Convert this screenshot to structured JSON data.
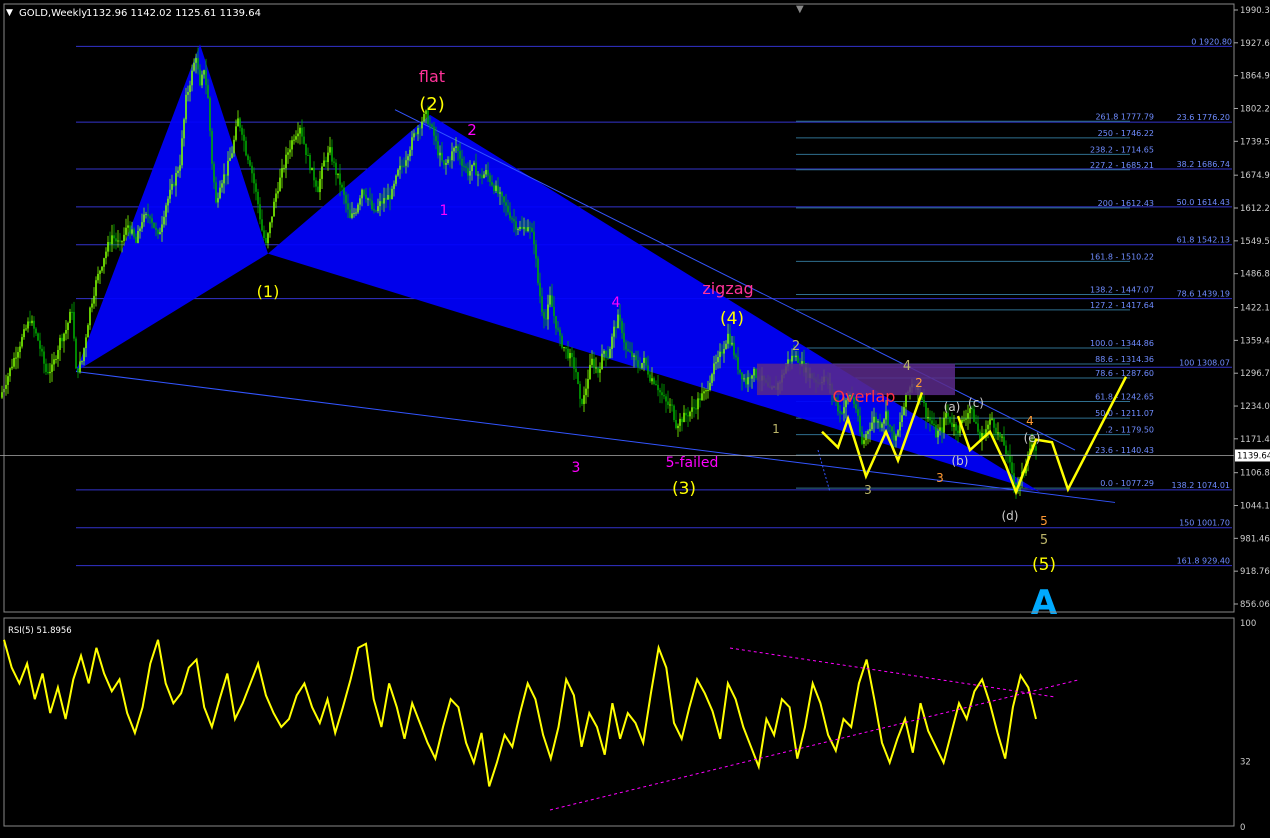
{
  "header": {
    "symbol_label": "GOLD,Weekly",
    "ohlc": "1132.96 1142.02 1125.61 1139.64",
    "current_price": "1139.64"
  },
  "colors": {
    "background": "#000000",
    "candle_up": "#7fff00",
    "candle_down": "#00aa00",
    "triangle": "#0000ff",
    "fib_line": "#3333cc",
    "wave_yellow": "#ffff00",
    "wave_magenta": "#ff00ff",
    "wave_olive": "#bdb76b",
    "wave_orange": "#ff9933",
    "label_red": "#ff3344",
    "big_a": "#00aaff",
    "rsi_line": "#ffff00",
    "trend_dash": "#ff00ff",
    "overlap_box": "#5a2a8a"
  },
  "chart_data": [
    {
      "type": "candlestick",
      "title": "GOLD,Weekly",
      "ylim": [
        856.06,
        1990.3
      ],
      "y_ticks": [
        "1990.30",
        "1927.66",
        "1864.96",
        "1802.26",
        "1739.56",
        "1674.90",
        "1612.20",
        "1549.50",
        "1486.80",
        "1422.16",
        "1359.46",
        "1296.76",
        "1234.06",
        "1171.46",
        "1106.80",
        "1044.16",
        "981.46",
        "918.76",
        "856.06"
      ],
      "x_ticks": [],
      "close_path": [
        [
          0,
          1250
        ],
        [
          15,
          1330
        ],
        [
          30,
          1400
        ],
        [
          38,
          1360
        ],
        [
          46,
          1300
        ],
        [
          52,
          1305
        ],
        [
          60,
          1360
        ],
        [
          66,
          1380
        ],
        [
          72,
          1420
        ],
        [
          76,
          1300
        ],
        [
          82,
          1320
        ],
        [
          90,
          1420
        ],
        [
          96,
          1470
        ],
        [
          104,
          1520
        ],
        [
          112,
          1560
        ],
        [
          120,
          1540
        ],
        [
          128,
          1580
        ],
        [
          136,
          1545
        ],
        [
          142,
          1590
        ],
        [
          150,
          1600
        ],
        [
          158,
          1555
        ],
        [
          166,
          1620
        ],
        [
          172,
          1650
        ],
        [
          180,
          1700
        ],
        [
          186,
          1820
        ],
        [
          192,
          1870
        ],
        [
          196,
          1905
        ],
        [
          200,
          1840
        ],
        [
          204,
          1880
        ],
        [
          208,
          1820
        ],
        [
          212,
          1700
        ],
        [
          216,
          1620
        ],
        [
          220,
          1660
        ],
        [
          226,
          1680
        ],
        [
          232,
          1720
        ],
        [
          238,
          1780
        ],
        [
          242,
          1760
        ],
        [
          246,
          1720
        ],
        [
          250,
          1700
        ],
        [
          254,
          1660
        ],
        [
          258,
          1620
        ],
        [
          262,
          1570
        ],
        [
          266,
          1540
        ],
        [
          270,
          1580
        ],
        [
          276,
          1640
        ],
        [
          282,
          1680
        ],
        [
          288,
          1720
        ],
        [
          294,
          1750
        ],
        [
          300,
          1770
        ],
        [
          306,
          1720
        ],
        [
          312,
          1680
        ],
        [
          318,
          1650
        ],
        [
          324,
          1700
        ],
        [
          330,
          1720
        ],
        [
          336,
          1680
        ],
        [
          340,
          1660
        ],
        [
          346,
          1620
        ],
        [
          350,
          1590
        ],
        [
          356,
          1610
        ],
        [
          362,
          1650
        ],
        [
          368,
          1630
        ],
        [
          374,
          1600
        ],
        [
          380,
          1620
        ],
        [
          386,
          1630
        ],
        [
          392,
          1640
        ],
        [
          398,
          1680
        ],
        [
          404,
          1700
        ],
        [
          410,
          1730
        ],
        [
          416,
          1760
        ],
        [
          422,
          1780
        ],
        [
          426,
          1790
        ],
        [
          430,
          1770
        ],
        [
          434,
          1750
        ],
        [
          438,
          1720
        ],
        [
          444,
          1690
        ],
        [
          450,
          1710
        ],
        [
          456,
          1730
        ],
        [
          462,
          1700
        ],
        [
          468,
          1680
        ],
        [
          474,
          1690
        ],
        [
          480,
          1670
        ],
        [
          486,
          1680
        ],
        [
          492,
          1660
        ],
        [
          498,
          1640
        ],
        [
          504,
          1620
        ],
        [
          510,
          1600
        ],
        [
          516,
          1580
        ],
        [
          522,
          1570
        ],
        [
          528,
          1580
        ],
        [
          534,
          1550
        ],
        [
          538,
          1470
        ],
        [
          542,
          1420
        ],
        [
          546,
          1400
        ],
        [
          550,
          1440
        ],
        [
          556,
          1390
        ],
        [
          560,
          1360
        ],
        [
          566,
          1340
        ],
        [
          572,
          1320
        ],
        [
          576,
          1300
        ],
        [
          580,
          1240
        ],
        [
          584,
          1250
        ],
        [
          588,
          1290
        ],
        [
          592,
          1320
        ],
        [
          598,
          1300
        ],
        [
          604,
          1340
        ],
        [
          608,
          1330
        ],
        [
          614,
          1380
        ],
        [
          618,
          1400
        ],
        [
          622,
          1380
        ],
        [
          626,
          1340
        ],
        [
          632,
          1330
        ],
        [
          638,
          1310
        ],
        [
          644,
          1320
        ],
        [
          650,
          1290
        ],
        [
          656,
          1280
        ],
        [
          660,
          1260
        ],
        [
          666,
          1240
        ],
        [
          672,
          1230
        ],
        [
          676,
          1200
        ],
        [
          682,
          1210
        ],
        [
          688,
          1220
        ],
        [
          694,
          1230
        ],
        [
          700,
          1250
        ],
        [
          706,
          1260
        ],
        [
          712,
          1300
        ],
        [
          718,
          1320
        ],
        [
          722,
          1340
        ],
        [
          728,
          1370
        ],
        [
          732,
          1350
        ],
        [
          736,
          1320
        ],
        [
          740,
          1300
        ],
        [
          746,
          1280
        ],
        [
          752,
          1300
        ],
        [
          758,
          1290
        ],
        [
          764,
          1280
        ],
        [
          770,
          1260
        ],
        [
          776,
          1270
        ],
        [
          782,
          1290
        ],
        [
          788,
          1320
        ],
        [
          794,
          1330
        ],
        [
          800,
          1320
        ],
        [
          806,
          1300
        ],
        [
          812,
          1290
        ],
        [
          818,
          1280
        ],
        [
          824,
          1290
        ],
        [
          830,
          1270
        ],
        [
          836,
          1240
        ],
        [
          840,
          1220
        ],
        [
          846,
          1240
        ],
        [
          850,
          1260
        ],
        [
          856,
          1230
        ],
        [
          862,
          1160
        ],
        [
          868,
          1190
        ],
        [
          874,
          1210
        ],
        [
          880,
          1200
        ],
        [
          886,
          1220
        ],
        [
          892,
          1180
        ],
        [
          896,
          1170
        ],
        [
          900,
          1200
        ],
        [
          906,
          1250
        ],
        [
          912,
          1280
        ],
        [
          918,
          1270
        ],
        [
          922,
          1250
        ],
        [
          926,
          1220
        ],
        [
          932,
          1200
        ],
        [
          936,
          1180
        ],
        [
          942,
          1190
        ],
        [
          946,
          1220
        ],
        [
          952,
          1200
        ],
        [
          958,
          1190
        ],
        [
          964,
          1210
        ],
        [
          970,
          1230
        ],
        [
          976,
          1200
        ],
        [
          980,
          1170
        ],
        [
          986,
          1190
        ],
        [
          992,
          1210
        ],
        [
          998,
          1180
        ],
        [
          1004,
          1160
        ],
        [
          1010,
          1120
        ],
        [
          1016,
          1080
        ],
        [
          1020,
          1090
        ],
        [
          1024,
          1110
        ],
        [
          1028,
          1150
        ],
        [
          1032,
          1160
        ],
        [
          1036,
          1140
        ]
      ],
      "wave_labels": [
        {
          "text": "flat",
          "color": "#ff3399"
        },
        {
          "text": "(2)",
          "color": "#ffff00"
        },
        {
          "text": "2",
          "color": "#ff00ff"
        },
        {
          "text": "1",
          "color": "#ff00ff"
        },
        {
          "text": "(1)",
          "color": "#ffff00"
        },
        {
          "text": "4",
          "color": "#ff00ff"
        },
        {
          "text": "zigzag",
          "color": "#ff3399"
        },
        {
          "text": "(4)",
          "color": "#ffff00"
        },
        {
          "text": "3",
          "color": "#ff00ff"
        },
        {
          "text": "5-failed",
          "color": "#ff00ff"
        },
        {
          "text": "(3)",
          "color": "#ffff00"
        },
        {
          "text": "2",
          "color": "#bdb76b"
        },
        {
          "text": "1",
          "color": "#bdb76b"
        },
        {
          "text": "Overlap",
          "color": "#ff3344"
        },
        {
          "text": "3",
          "color": "#bdb76b"
        },
        {
          "text": "4",
          "color": "#bdb76b"
        },
        {
          "text": "2",
          "color": "#ff9933"
        },
        {
          "text": "3",
          "color": "#ff9933"
        },
        {
          "text": "4",
          "color": "#ff9933"
        },
        {
          "text": "5",
          "color": "#ff9933"
        },
        {
          "text": "5",
          "color": "#bdb76b"
        },
        {
          "text": "(5)",
          "color": "#ffff00"
        },
        {
          "text": "(a)",
          "color": "#cccccc"
        },
        {
          "text": "(c)",
          "color": "#cccccc"
        },
        {
          "text": "(b)",
          "color": "#cccccc"
        },
        {
          "text": "(e)",
          "color": "#cccccc"
        },
        {
          "text": "(d)",
          "color": "#cccccc"
        },
        {
          "text": "A",
          "color": "#00aaff"
        }
      ],
      "fib_left": [
        {
          "text": "0 1920.80"
        },
        {
          "text": "261.8 1777.79"
        },
        {
          "text": "250 - 1746.22"
        },
        {
          "text": "238.2 - 1714.65"
        },
        {
          "text": "227.2 - 1685.21"
        },
        {
          "text": "200 - 1612.43"
        },
        {
          "text": "161.8 - 1510.22"
        },
        {
          "text": "138.2 - 1447.07"
        },
        {
          "text": "127.2 - 1417.64"
        },
        {
          "text": "100.0 - 1344.86"
        },
        {
          "text": "88.6 - 1314.36"
        },
        {
          "text": "78.6 - 1287.60"
        },
        {
          "text": "61.8 - 1242.65"
        },
        {
          "text": "50.0 - 1211.07"
        },
        {
          "text": ".2 - 1179.50"
        },
        {
          "text": "23.6 - 1140.43"
        },
        {
          "text": "0.0 - 1077.29"
        }
      ],
      "fib_right": [
        {
          "text": "23.6 1776.20"
        },
        {
          "text": "38.2 1686.74"
        },
        {
          "text": "50.0 1614.43"
        },
        {
          "text": "61.8 1542.13"
        },
        {
          "text": "78.6 1439.19"
        },
        {
          "text": "100 1308.07"
        },
        {
          "text": "138.2 1074.01"
        },
        {
          "text": "150 1001.70"
        },
        {
          "text": "161.8 929.40"
        }
      ]
    },
    {
      "type": "line",
      "title": "RSI(5) 51.8956",
      "ylim": [
        0,
        100
      ],
      "y_ticks": [
        "100",
        "32",
        "0"
      ],
      "series": [
        {
          "values": [
            92,
            78,
            70,
            80,
            62,
            75,
            55,
            68,
            52,
            72,
            84,
            70,
            88,
            75,
            66,
            72,
            55,
            45,
            58,
            80,
            92,
            70,
            60,
            65,
            78,
            82,
            58,
            48,
            62,
            75,
            52,
            60,
            70,
            80,
            64,
            55,
            48,
            52,
            64,
            70,
            58,
            50,
            62,
            45,
            58,
            72,
            88,
            90,
            62,
            48,
            70,
            58,
            42,
            60,
            50,
            40,
            32,
            48,
            62,
            58,
            40,
            30,
            45,
            18,
            30,
            44,
            38,
            55,
            70,
            62,
            44,
            32,
            48,
            72,
            64,
            38,
            55,
            48,
            34,
            60,
            42,
            55,
            50,
            40,
            65,
            88,
            78,
            50,
            42,
            58,
            72,
            65,
            56,
            42,
            70,
            62,
            48,
            38,
            28,
            52,
            44,
            62,
            58,
            32,
            48,
            70,
            60,
            44,
            36,
            52,
            48,
            70,
            82,
            62,
            40,
            30,
            42,
            52,
            35,
            60,
            46,
            38,
            30,
            45,
            60,
            52,
            66,
            72,
            60,
            45,
            32,
            58,
            74,
            68,
            52
          ]
        }
      ]
    }
  ]
}
